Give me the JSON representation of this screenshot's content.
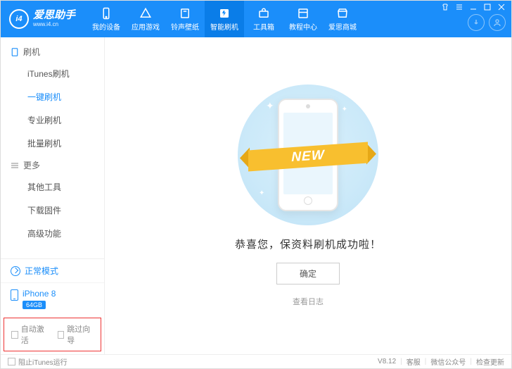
{
  "header": {
    "logo_text": "i4",
    "brand_text": "爱思助手",
    "brand_sub": "www.i4.cn",
    "nav": [
      {
        "label": "我的设备",
        "icon": "phone"
      },
      {
        "label": "应用游戏",
        "icon": "apps"
      },
      {
        "label": "铃声壁纸",
        "icon": "music"
      },
      {
        "label": "智能刷机",
        "icon": "flash",
        "active": true
      },
      {
        "label": "工具箱",
        "icon": "toolbox"
      },
      {
        "label": "教程中心",
        "icon": "book"
      },
      {
        "label": "爱思商城",
        "icon": "store"
      }
    ]
  },
  "sidebar": {
    "sections": [
      {
        "title": "刷机",
        "items": [
          "iTunes刷机",
          "一键刷机",
          "专业刷机",
          "批量刷机"
        ],
        "selected_index": 1
      },
      {
        "title": "更多",
        "items": [
          "其他工具",
          "下载固件",
          "高级功能"
        ]
      }
    ],
    "mode_label": "正常模式",
    "device_name": "iPhone 8",
    "device_storage": "64GB",
    "checks": {
      "auto_activate": "自动激活",
      "skip_guide": "跳过向导"
    }
  },
  "main": {
    "ribbon_text": "NEW",
    "success_text": "恭喜您，保资料刷机成功啦！",
    "ok_button": "确定",
    "view_log": "查看日志"
  },
  "footer": {
    "block_itunes": "阻止iTunes运行",
    "version": "V8.12",
    "support": "客服",
    "wechat": "微信公众号",
    "update": "检查更新"
  }
}
